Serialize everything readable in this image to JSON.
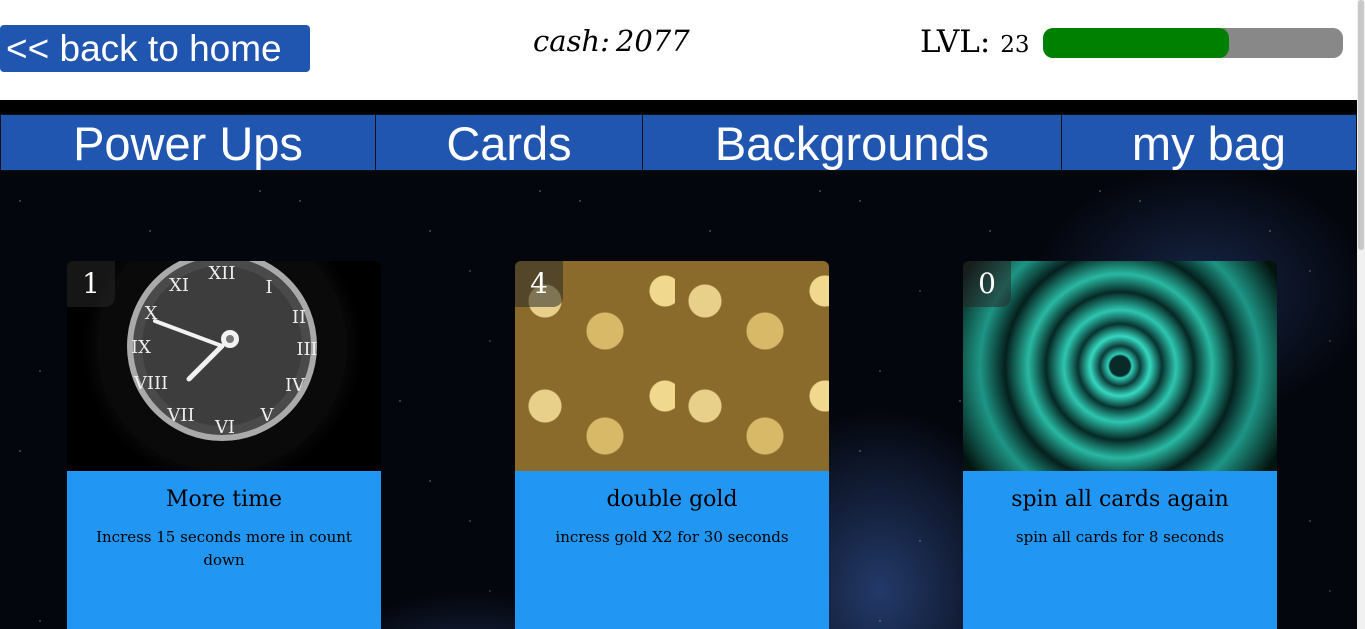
{
  "header": {
    "back_label": "<< back to home",
    "cash_label": "cash:",
    "cash_value": "2077",
    "lvl_label": "LVL:",
    "lvl_value": "23",
    "xp_progress": 0.62,
    "xp_color": "#008000",
    "xp_track_color": "#888888"
  },
  "tabs": [
    {
      "label": "Power Ups"
    },
    {
      "label": "Cards"
    },
    {
      "label": "Backgrounds"
    },
    {
      "label": "my bag"
    }
  ],
  "cards": [
    {
      "count": "1",
      "title": "More time",
      "description": "Incress 15 seconds more in count down",
      "image": "clock-image"
    },
    {
      "count": "4",
      "title": "double gold",
      "description": "incress gold X2 for 30 seconds",
      "image": "gold-coins-image"
    },
    {
      "count": "0",
      "title": "spin all cards again",
      "description": "spin all cards for 8 seconds",
      "image": "spiral-image"
    }
  ],
  "colors": {
    "accent_blue": "#2055b0",
    "card_body_blue": "#2196f3"
  }
}
